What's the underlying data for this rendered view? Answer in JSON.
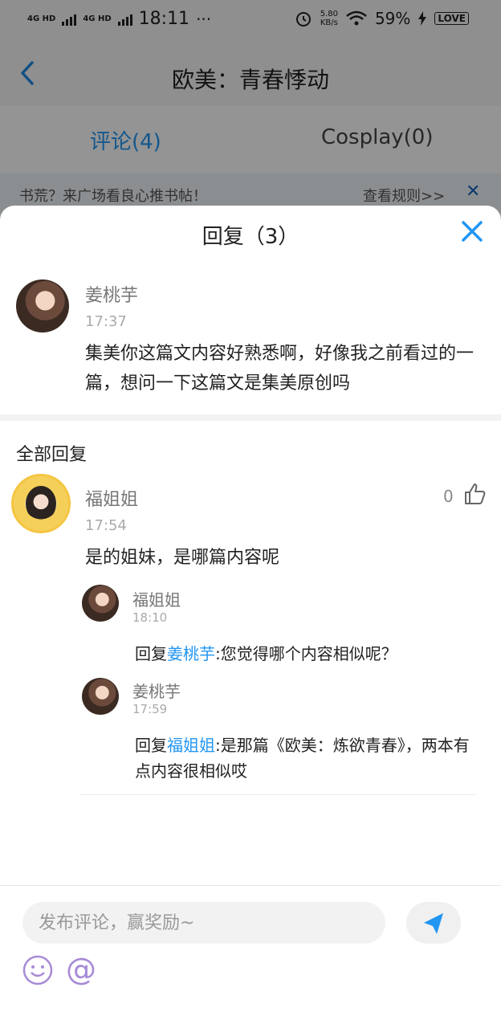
{
  "status_bar": {
    "signal1": "4G HD",
    "signal2": "4G HD",
    "time": "18:11",
    "more": "···",
    "net_speed_value": "5.80",
    "net_speed_unit": "KB/s",
    "battery": "59%",
    "badge": "LOVE"
  },
  "header": {
    "title": "欧美：青春悸动",
    "back_icon": "chevron-left-icon"
  },
  "tabs": [
    {
      "label": "评论(4)",
      "active": true
    },
    {
      "label": "Cosplay(0)",
      "active": false
    }
  ],
  "notice": {
    "text": "书荒？来广场看良心推书帖！",
    "link": "查看规则>>",
    "close": "✕"
  },
  "sheet": {
    "title": "回复（3）",
    "original": {
      "author": "姜桃芋",
      "time": "17:37",
      "text": "集美你这篇文内容好熟悉啊，好像我之前看过的一篇，想问一下这篇文是集美原创吗"
    },
    "section_title": "全部回复",
    "reply": {
      "author": "福姐姐",
      "time": "17:54",
      "text": "是的姐妹，是哪篇内容呢",
      "likes": "0"
    },
    "sub_replies": [
      {
        "author": "福姐姐",
        "time": "18:10",
        "prefix": "回复",
        "mention": "姜桃芋",
        "text": ":您觉得哪个内容相似呢？"
      },
      {
        "author": "姜桃芋",
        "time": "17:59",
        "prefix": "回复",
        "mention": "福姐姐",
        "text": ":是那篇《欧美：炼欲青春》，两本有点内容很相似哎"
      }
    ]
  },
  "input": {
    "placeholder": "发布评论，赢奖励~"
  },
  "colors": {
    "accent": "#2196f3",
    "mention": "#2196f3",
    "emoji": "#a78bd6"
  }
}
